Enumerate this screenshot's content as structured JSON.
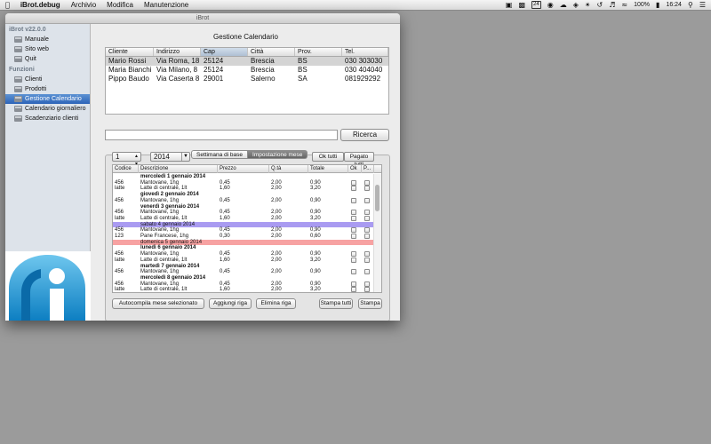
{
  "menubar": {
    "apple_icon": "apple-icon",
    "app_name": "iBrot.debug",
    "menus": [
      "Archivio",
      "Modifica",
      "Manutenzione"
    ],
    "calendar_day": "24",
    "battery": "100%",
    "clock": "16:24"
  },
  "window": {
    "title": "iBrot"
  },
  "sidebar": {
    "version": "iBrot v22.0.0",
    "items_top": [
      {
        "label": "Manuale"
      },
      {
        "label": "Sito web"
      },
      {
        "label": "Quit"
      }
    ],
    "section": "Funzioni",
    "items_functions": [
      {
        "label": "Clienti"
      },
      {
        "label": "Prodotti"
      },
      {
        "label": "Gestione Calendario",
        "selected": true
      },
      {
        "label": "Calendario giornaliero"
      },
      {
        "label": "Scadenziario clienti"
      }
    ],
    "accent": "#2d64b8"
  },
  "main": {
    "title": "Gestione Calendario",
    "clients_table": {
      "headers": [
        "Cliente",
        "Indirizzo",
        "Cap",
        "Città",
        "Prov.",
        "Tel."
      ],
      "rows": [
        [
          "Mario Rossi",
          "Via Roma, 18",
          "25124",
          "Brescia",
          "BS",
          "030 303030"
        ],
        [
          "Maria Bianchi",
          "Via Milano, 8",
          "25124",
          "Brescia",
          "BS",
          "030 404040"
        ],
        [
          "Pippo Baudo",
          "Via Caserta 8",
          "29001",
          "Salerno",
          "SA",
          "081929292"
        ]
      ],
      "selected_row": 0
    },
    "search_value": "",
    "search_button": "Ricerca",
    "tabs": [
      "Settimana di base",
      "Impostazione mese"
    ],
    "active_tab": 1,
    "month_value": "1",
    "year_value": "2014",
    "ok_all_button": "Ok tutti",
    "paid_all_button": "Pagato tutti",
    "rows_table": {
      "headers": [
        "Codice",
        "Descrizione",
        "Prezzo",
        "Q.tà",
        "Totale",
        "Ok",
        "P..."
      ],
      "rows": [
        {
          "type": "day",
          "desc": "mercoledì 1 gennaio 2014"
        },
        {
          "type": "item",
          "code": "456",
          "desc": "Mantovane, 1hg",
          "price": "0,45",
          "qty": "2,00",
          "total": "0,90"
        },
        {
          "type": "item",
          "code": "latte",
          "desc": "Latte di centrale, 1lt",
          "price": "1,60",
          "qty": "2,00",
          "total": "3,20"
        },
        {
          "type": "day",
          "desc": "giovedì 2 gennaio 2014"
        },
        {
          "type": "item",
          "code": "456",
          "desc": "Mantovane, 1hg",
          "price": "0,45",
          "qty": "2,00",
          "total": "0,90"
        },
        {
          "type": "day",
          "desc": "venerdì 3 gennaio 2014"
        },
        {
          "type": "item",
          "code": "456",
          "desc": "Mantovane, 1hg",
          "price": "0,45",
          "qty": "2,00",
          "total": "0,90"
        },
        {
          "type": "item",
          "code": "latte",
          "desc": "Latte di centrale, 1lt",
          "price": "1,60",
          "qty": "2,00",
          "total": "3,20"
        },
        {
          "type": "sat",
          "desc": "sabato 4 gennaio 2014"
        },
        {
          "type": "item",
          "code": "456",
          "desc": "Mantovane, 1hg",
          "price": "0,45",
          "qty": "2,00",
          "total": "0,90"
        },
        {
          "type": "item",
          "code": "123",
          "desc": "Pane Francese, 1hg",
          "price": "0,30",
          "qty": "2,00",
          "total": "0,60"
        },
        {
          "type": "sun",
          "desc": "domenica 5 gennaio 2014"
        },
        {
          "type": "day",
          "desc": "lunedì 6 gennaio 2014"
        },
        {
          "type": "item",
          "code": "456",
          "desc": "Mantovane, 1hg",
          "price": "0,45",
          "qty": "2,00",
          "total": "0,90"
        },
        {
          "type": "item",
          "code": "latte",
          "desc": "Latte di centrale, 1lt",
          "price": "1,60",
          "qty": "2,00",
          "total": "3,20"
        },
        {
          "type": "day",
          "desc": "martedì 7 gennaio 2014"
        },
        {
          "type": "item",
          "code": "456",
          "desc": "Mantovane, 1hg",
          "price": "0,45",
          "qty": "2,00",
          "total": "0,90"
        },
        {
          "type": "day",
          "desc": "mercoledì 8 gennaio 2014"
        },
        {
          "type": "item",
          "code": "456",
          "desc": "Mantovane, 1hg",
          "price": "0,45",
          "qty": "2,00",
          "total": "0,90"
        },
        {
          "type": "item",
          "code": "latte",
          "desc": "Latte di centrale, 1lt",
          "price": "1,60",
          "qty": "2,00",
          "total": "3,20"
        },
        {
          "type": "day",
          "desc": "giovedì 9 gennaio 2014"
        }
      ]
    },
    "buttons": {
      "autofill": "Autocompila mese selezionato",
      "add_row": "Aggiungi riga",
      "delete_row": "Elimina riga",
      "print_all": "Stampa tutti",
      "print": "Stampa"
    }
  }
}
